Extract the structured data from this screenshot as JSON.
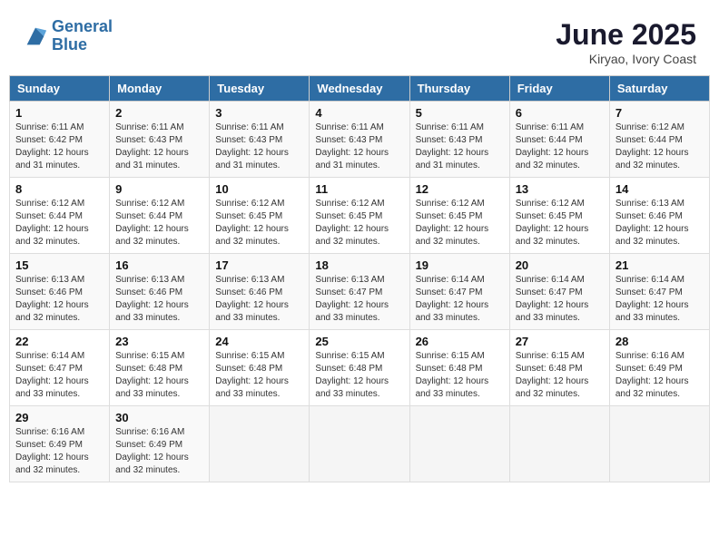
{
  "header": {
    "logo_line1": "General",
    "logo_line2": "Blue",
    "month": "June 2025",
    "location": "Kiryao, Ivory Coast"
  },
  "days_of_week": [
    "Sunday",
    "Monday",
    "Tuesday",
    "Wednesday",
    "Thursday",
    "Friday",
    "Saturday"
  ],
  "weeks": [
    [
      {
        "day": 1,
        "info": "Sunrise: 6:11 AM\nSunset: 6:42 PM\nDaylight: 12 hours\nand 31 minutes."
      },
      {
        "day": 2,
        "info": "Sunrise: 6:11 AM\nSunset: 6:43 PM\nDaylight: 12 hours\nand 31 minutes."
      },
      {
        "day": 3,
        "info": "Sunrise: 6:11 AM\nSunset: 6:43 PM\nDaylight: 12 hours\nand 31 minutes."
      },
      {
        "day": 4,
        "info": "Sunrise: 6:11 AM\nSunset: 6:43 PM\nDaylight: 12 hours\nand 31 minutes."
      },
      {
        "day": 5,
        "info": "Sunrise: 6:11 AM\nSunset: 6:43 PM\nDaylight: 12 hours\nand 31 minutes."
      },
      {
        "day": 6,
        "info": "Sunrise: 6:11 AM\nSunset: 6:44 PM\nDaylight: 12 hours\nand 32 minutes."
      },
      {
        "day": 7,
        "info": "Sunrise: 6:12 AM\nSunset: 6:44 PM\nDaylight: 12 hours\nand 32 minutes."
      }
    ],
    [
      {
        "day": 8,
        "info": "Sunrise: 6:12 AM\nSunset: 6:44 PM\nDaylight: 12 hours\nand 32 minutes."
      },
      {
        "day": 9,
        "info": "Sunrise: 6:12 AM\nSunset: 6:44 PM\nDaylight: 12 hours\nand 32 minutes."
      },
      {
        "day": 10,
        "info": "Sunrise: 6:12 AM\nSunset: 6:45 PM\nDaylight: 12 hours\nand 32 minutes."
      },
      {
        "day": 11,
        "info": "Sunrise: 6:12 AM\nSunset: 6:45 PM\nDaylight: 12 hours\nand 32 minutes."
      },
      {
        "day": 12,
        "info": "Sunrise: 6:12 AM\nSunset: 6:45 PM\nDaylight: 12 hours\nand 32 minutes."
      },
      {
        "day": 13,
        "info": "Sunrise: 6:12 AM\nSunset: 6:45 PM\nDaylight: 12 hours\nand 32 minutes."
      },
      {
        "day": 14,
        "info": "Sunrise: 6:13 AM\nSunset: 6:46 PM\nDaylight: 12 hours\nand 32 minutes."
      }
    ],
    [
      {
        "day": 15,
        "info": "Sunrise: 6:13 AM\nSunset: 6:46 PM\nDaylight: 12 hours\nand 32 minutes."
      },
      {
        "day": 16,
        "info": "Sunrise: 6:13 AM\nSunset: 6:46 PM\nDaylight: 12 hours\nand 33 minutes."
      },
      {
        "day": 17,
        "info": "Sunrise: 6:13 AM\nSunset: 6:46 PM\nDaylight: 12 hours\nand 33 minutes."
      },
      {
        "day": 18,
        "info": "Sunrise: 6:13 AM\nSunset: 6:47 PM\nDaylight: 12 hours\nand 33 minutes."
      },
      {
        "day": 19,
        "info": "Sunrise: 6:14 AM\nSunset: 6:47 PM\nDaylight: 12 hours\nand 33 minutes."
      },
      {
        "day": 20,
        "info": "Sunrise: 6:14 AM\nSunset: 6:47 PM\nDaylight: 12 hours\nand 33 minutes."
      },
      {
        "day": 21,
        "info": "Sunrise: 6:14 AM\nSunset: 6:47 PM\nDaylight: 12 hours\nand 33 minutes."
      }
    ],
    [
      {
        "day": 22,
        "info": "Sunrise: 6:14 AM\nSunset: 6:47 PM\nDaylight: 12 hours\nand 33 minutes."
      },
      {
        "day": 23,
        "info": "Sunrise: 6:15 AM\nSunset: 6:48 PM\nDaylight: 12 hours\nand 33 minutes."
      },
      {
        "day": 24,
        "info": "Sunrise: 6:15 AM\nSunset: 6:48 PM\nDaylight: 12 hours\nand 33 minutes."
      },
      {
        "day": 25,
        "info": "Sunrise: 6:15 AM\nSunset: 6:48 PM\nDaylight: 12 hours\nand 33 minutes."
      },
      {
        "day": 26,
        "info": "Sunrise: 6:15 AM\nSunset: 6:48 PM\nDaylight: 12 hours\nand 33 minutes."
      },
      {
        "day": 27,
        "info": "Sunrise: 6:15 AM\nSunset: 6:48 PM\nDaylight: 12 hours\nand 32 minutes."
      },
      {
        "day": 28,
        "info": "Sunrise: 6:16 AM\nSunset: 6:49 PM\nDaylight: 12 hours\nand 32 minutes."
      }
    ],
    [
      {
        "day": 29,
        "info": "Sunrise: 6:16 AM\nSunset: 6:49 PM\nDaylight: 12 hours\nand 32 minutes."
      },
      {
        "day": 30,
        "info": "Sunrise: 6:16 AM\nSunset: 6:49 PM\nDaylight: 12 hours\nand 32 minutes."
      },
      null,
      null,
      null,
      null,
      null
    ]
  ]
}
